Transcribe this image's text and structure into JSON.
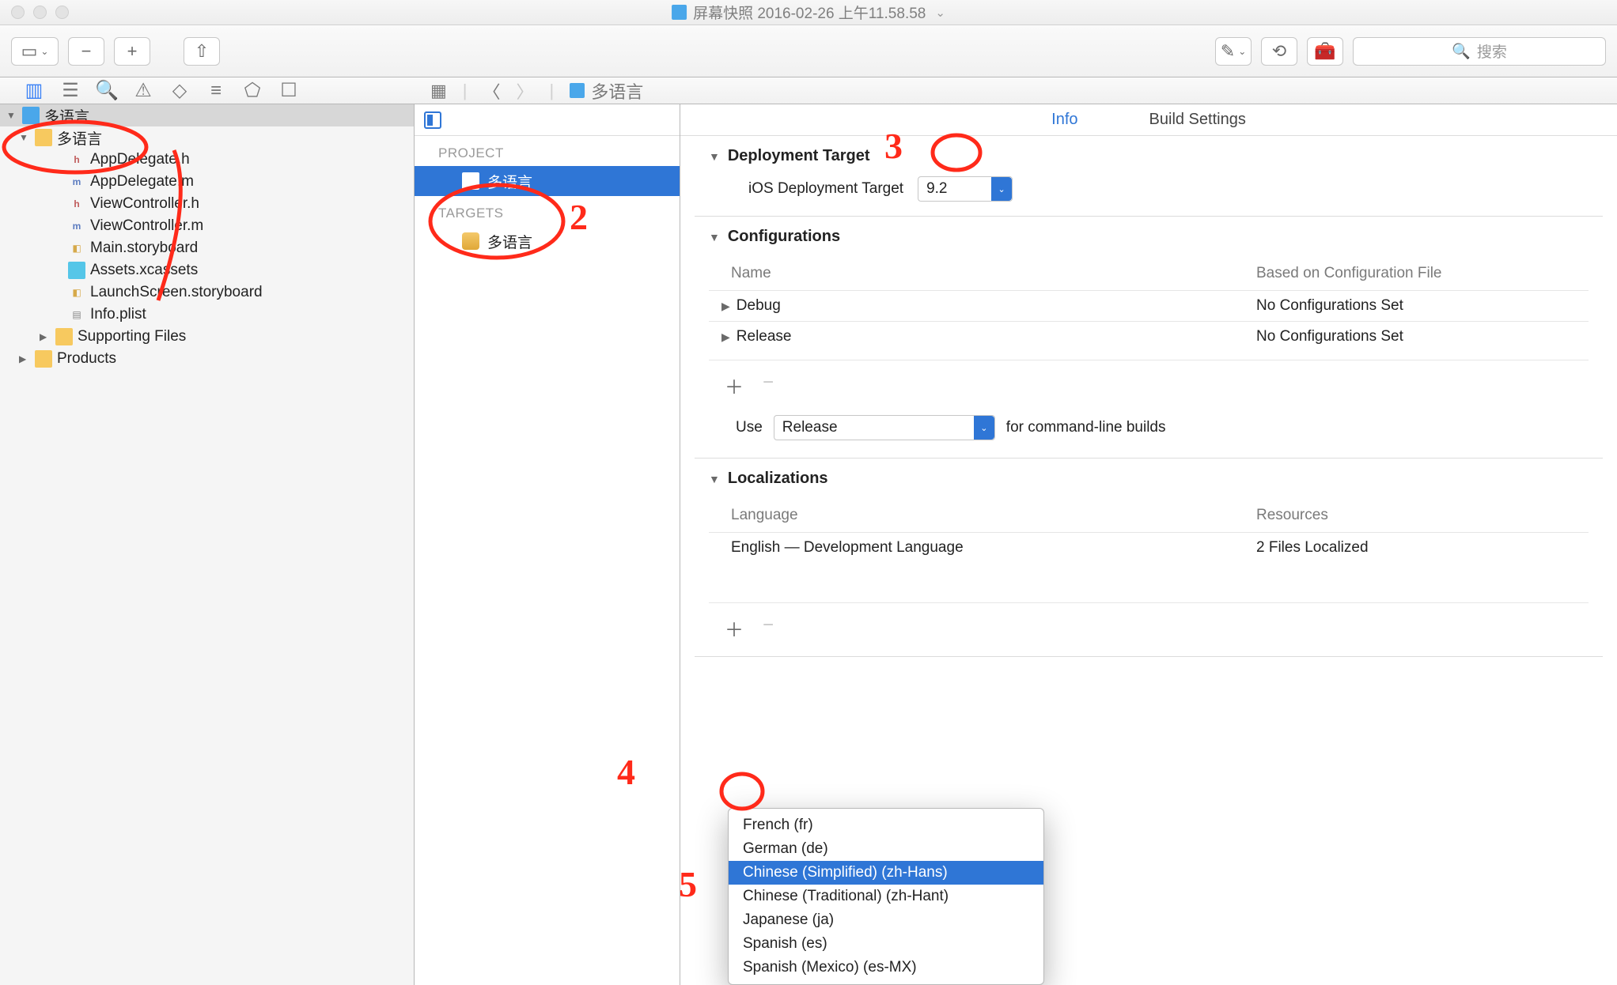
{
  "window": {
    "title": "屏幕快照 2016-02-26 上午11.58.58"
  },
  "search": {
    "placeholder": "搜索"
  },
  "breadcrumb": {
    "name": "多语言"
  },
  "navigator": {
    "root": "多语言",
    "group": "多语言",
    "files": {
      "appdelegate_h": "AppDelegate.h",
      "appdelegate_m": "AppDelegate.m",
      "viewcontroller_h": "ViewController.h",
      "viewcontroller_m": "ViewController.m",
      "main_sb": "Main.storyboard",
      "assets": "Assets.xcassets",
      "launch_sb": "LaunchScreen.storyboard",
      "info_plist": "Info.plist",
      "supporting": "Supporting Files",
      "products": "Products"
    }
  },
  "project_list": {
    "project_label": "PROJECT",
    "targets_label": "TARGETS",
    "project_name": "多语言",
    "target_name": "多语言"
  },
  "tabs": {
    "info": "Info",
    "build": "Build Settings"
  },
  "deployment": {
    "title": "Deployment Target",
    "label": "iOS Deployment Target",
    "value": "9.2"
  },
  "configurations": {
    "title": "Configurations",
    "col_name": "Name",
    "col_based": "Based on Configuration File",
    "rows": [
      {
        "name": "Debug",
        "based": "No Configurations Set"
      },
      {
        "name": "Release",
        "based": "No Configurations Set"
      }
    ],
    "use_label": "Use",
    "use_value": "Release",
    "use_suffix": "for command-line builds"
  },
  "localizations": {
    "title": "Localizations",
    "col_lang": "Language",
    "col_res": "Resources",
    "rows": [
      {
        "lang": "English — Development Language",
        "res": "2 Files Localized"
      }
    ]
  },
  "popup": {
    "items": {
      "fr": "French (fr)",
      "de": "German (de)",
      "zh_hans": "Chinese (Simplified) (zh-Hans)",
      "zh_hant": "Chinese (Traditional) (zh-Hant)",
      "ja": "Japanese (ja)",
      "es": "Spanish (es)",
      "es_mx": "Spanish (Mexico) (es-MX)"
    }
  }
}
